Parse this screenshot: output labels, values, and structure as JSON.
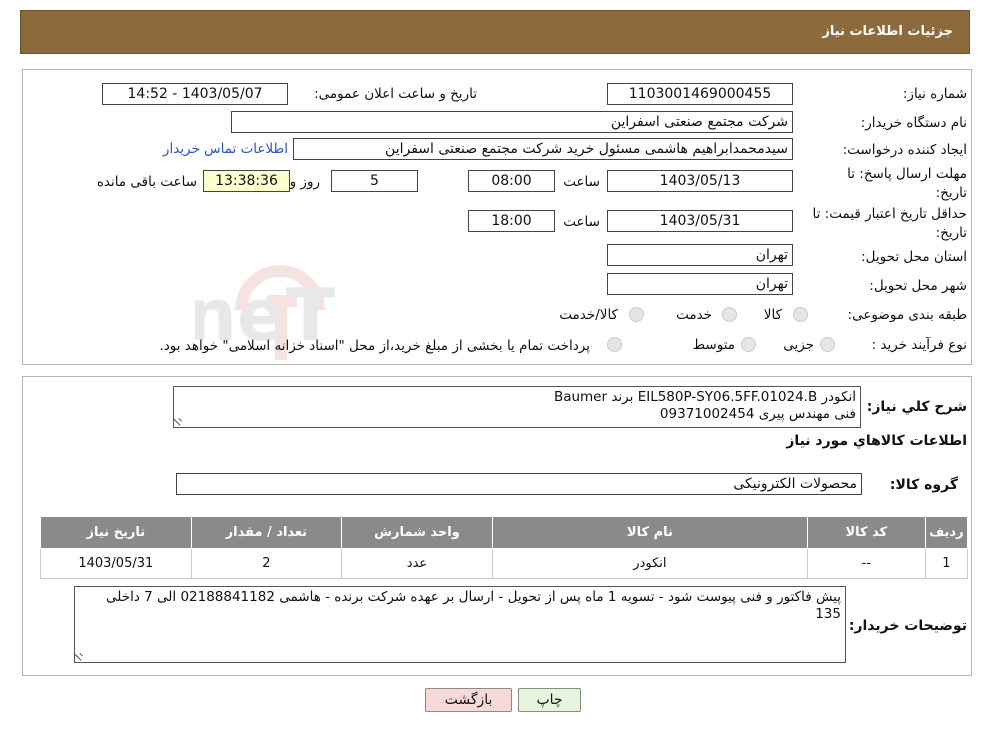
{
  "header": {
    "title": "جزئیات اطلاعات نیاز"
  },
  "watermark": {
    "text": "AriaTender.neT"
  },
  "request": {
    "number_label": "شماره نیاز:",
    "number_value": "1103001469000455",
    "announce_label": "تاریخ و ساعت اعلان عمومی:",
    "announce_value": "1403/05/07 - 14:52",
    "buyer_org_label": "نام دستگاه خریدار:",
    "buyer_org_value": "شرکت مجتمع صنعتی اسفراین",
    "creator_label": "ایجاد کننده درخواست:",
    "creator_value": "سیدمحمدابراهیم هاشمی مسئول خرید شرکت مجتمع صنعتی اسفراین",
    "contact_link": "اطلاعات تماس خریدار",
    "deadline_label_1": "مهلت ارسال پاسخ: تا",
    "deadline_label_2": "تاریخ:",
    "deadline_date": "1403/05/13",
    "time_label": "ساعت",
    "deadline_time": "08:00",
    "days_value": "5",
    "days_label": "روز و",
    "remaining_time": "13:38:36",
    "remaining_label": "ساعت باقی مانده",
    "validity_label_1": "حداقل تاریخ اعتبار قیمت: تا",
    "validity_label_2": "تاریخ:",
    "validity_date": "1403/05/31",
    "validity_time": "18:00",
    "province_label": "استان محل تحویل:",
    "province_value": "تهران",
    "city_label": "شهر محل تحویل:",
    "city_value": "تهران",
    "category_label": "طبقه بندی موضوعی:",
    "category_options": [
      "کالا",
      "خدمت",
      "کالا/خدمت"
    ],
    "process_label": "نوع فرآیند خرید :",
    "process_options": [
      "جزیی",
      "متوسط"
    ],
    "process_note": "پرداخت تمام یا بخشی از مبلغ خرید،از محل \"اسناد خزانه اسلامی\" خواهد بود."
  },
  "summary": {
    "label": "شرح کلي نياز:",
    "line1": "انکودر EIL580P-SY06.5FF.01024.B برند Baumer",
    "line2": "فنی مهندس پیری 09371002454"
  },
  "goods": {
    "section_title": "اطلاعات کالاهاي مورد نياز",
    "group_label": "گروه کالا:",
    "group_value": "محصولات الکترونیکی",
    "columns": [
      "رديف",
      "کد کالا",
      "نام کالا",
      "واحد شمارش",
      "تعداد / مقدار",
      "تاريخ نياز"
    ],
    "rows": [
      [
        "1",
        "--",
        "انکودر",
        "عدد",
        "2",
        "1403/05/31"
      ]
    ]
  },
  "buyer_notes": {
    "label": "توضیحات خریدار:",
    "text": "پیش فاکتور و فنی پیوست شود - تسویه 1 ماه پس از تحویل - ارسال بر عهده شرکت برنده - هاشمی 02188841182 الی 7 داخلی 135"
  },
  "buttons": {
    "print": "چاپ",
    "back": "بازگشت"
  },
  "colors": {
    "header": "#8d6a3c",
    "table_header": "#8a8a8a",
    "remaining_bg": "#ffffcc",
    "back_button": "#f7d9d9",
    "print_button": "#e6f5dc"
  }
}
